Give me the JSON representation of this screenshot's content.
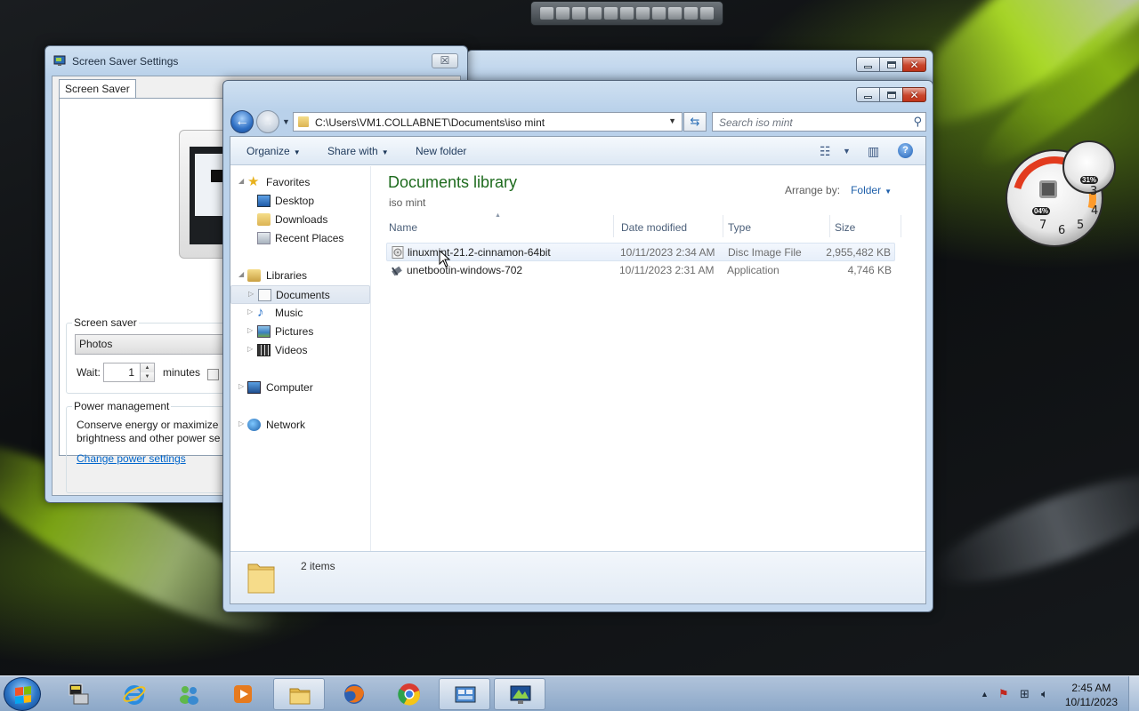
{
  "screen_saver_dialog": {
    "title": "Screen Saver Settings",
    "close_label": "☒",
    "tab_label": "Screen Saver",
    "screen_saver_group_label": "Screen saver",
    "selected_screen_saver": "Photos",
    "wait_label": "Wait:",
    "wait_value": "1",
    "minutes_label": "minutes",
    "power_group_label": "Power management",
    "power_text_line1": "Conserve energy or maximize",
    "power_text_line2": "brightness and other power se",
    "change_power_link": "Change power settings"
  },
  "explorer": {
    "address_path": "C:\\Users\\VM1.COLLABNET\\Documents\\iso mint",
    "search_placeholder": "Search iso mint",
    "toolbar": {
      "organize": "Organize",
      "share_with": "Share with",
      "new_folder": "New folder"
    },
    "nav_pane": {
      "favorites": "Favorites",
      "desktop": "Desktop",
      "downloads": "Downloads",
      "recent_places": "Recent Places",
      "libraries": "Libraries",
      "documents": "Documents",
      "music": "Music",
      "pictures": "Pictures",
      "videos": "Videos",
      "computer": "Computer",
      "network": "Network"
    },
    "library_title": "Documents library",
    "library_subtitle": "iso mint",
    "arrange_by_label": "Arrange by:",
    "arrange_by_value": "Folder",
    "columns": {
      "name": "Name",
      "date_modified": "Date modified",
      "type": "Type",
      "size": "Size"
    },
    "files": [
      {
        "name": "linuxmint-21.2-cinnamon-64bit",
        "date": "10/11/2023 2:34 AM",
        "type": "Disc Image File",
        "size": "2,955,482 KB"
      },
      {
        "name": "unetbootin-windows-702",
        "date": "10/11/2023 2:31 AM",
        "type": "Application",
        "size": "4,746 KB"
      }
    ],
    "item_count": "2 items"
  },
  "gadget": {
    "cpu_percent": "04%",
    "memory_percent": "31%",
    "dial_numbers": [
      "3",
      "4",
      "5",
      "6",
      "7"
    ]
  },
  "taskbar": {
    "clock_time": "2:45 AM",
    "clock_date": "10/11/2023"
  }
}
